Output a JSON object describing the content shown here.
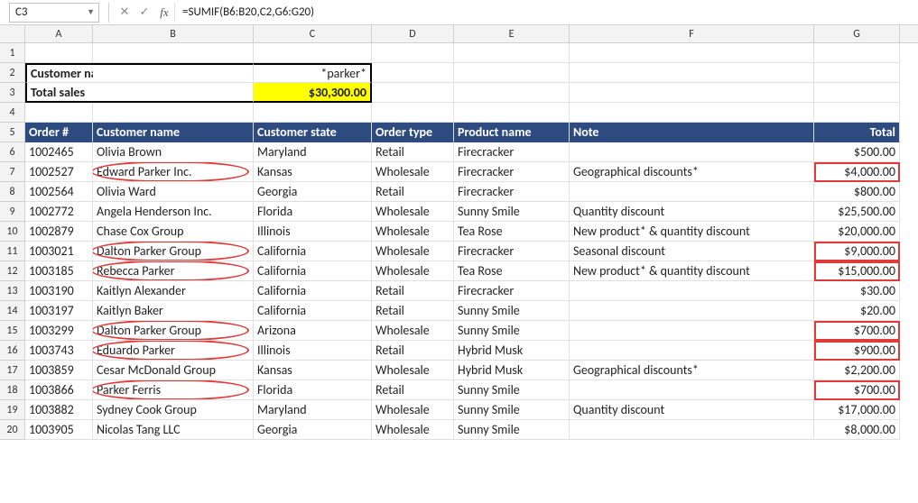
{
  "formula_bar": {
    "name_box": "C3",
    "formula": "=SUMIF(B6:B20,C2,G6:G20)",
    "cancel_icon": "✕",
    "enter_icon": "✓",
    "fx_label": "fx"
  },
  "columns": [
    "A",
    "B",
    "C",
    "D",
    "E",
    "F",
    "G"
  ],
  "summary": {
    "label1": "Customer name contains",
    "value1": "*parker*",
    "label2": "Total sales",
    "value2": "$30,300.00"
  },
  "table_headers": {
    "A": "Order #",
    "B": "Customer name",
    "C": "Customer state",
    "D": "Order type",
    "E": "Product name",
    "F": "Note",
    "G": "Total"
  },
  "rows": [
    {
      "r": 6,
      "A": "1002465",
      "B": "Olivia Brown",
      "C": "Maryland",
      "D": "Retail",
      "E": "Firecracker",
      "F": "",
      "G": "$500.00",
      "hB": false,
      "hG": false
    },
    {
      "r": 7,
      "A": "1002527",
      "B": "Edward Parker Inc.",
      "C": "Kansas",
      "D": "Wholesale",
      "E": "Firecracker",
      "F": "Geographical discounts*",
      "G": "$4,000.00",
      "hB": true,
      "hG": true
    },
    {
      "r": 8,
      "A": "1002564",
      "B": "Olivia Ward",
      "C": "Georgia",
      "D": "Retail",
      "E": "Firecracker",
      "F": "",
      "G": "$800.00",
      "hB": false,
      "hG": false
    },
    {
      "r": 9,
      "A": "1002772",
      "B": "Angela Henderson Inc.",
      "C": "Florida",
      "D": "Wholesale",
      "E": "Sunny Smile",
      "F": "Quantity discount",
      "G": "$25,500.00",
      "hB": false,
      "hG": false
    },
    {
      "r": 10,
      "A": "1002879",
      "B": "Chase Cox Group",
      "C": "Illinois",
      "D": "Wholesale",
      "E": "Tea Rose",
      "F": "New product* & quantity discount",
      "G": "$20,000.00",
      "hB": false,
      "hG": false
    },
    {
      "r": 11,
      "A": "1003021",
      "B": "Dalton Parker Group",
      "C": "California",
      "D": "Wholesale",
      "E": "Firecracker",
      "F": "Seasonal discount",
      "G": "$9,000.00",
      "hB": true,
      "hG": true
    },
    {
      "r": 12,
      "A": "1003185",
      "B": "Rebecca Parker",
      "C": "California",
      "D": "Wholesale",
      "E": "Tea Rose",
      "F": "New product* & quantity discount",
      "G": "$15,000.00",
      "hB": true,
      "hG": true
    },
    {
      "r": 13,
      "A": "1003190",
      "B": "Kaitlyn Alexander",
      "C": "California",
      "D": "Retail",
      "E": "Firecracker",
      "F": "",
      "G": "$30.00",
      "hB": false,
      "hG": false
    },
    {
      "r": 14,
      "A": "1003197",
      "B": "Kaitlyn Baker",
      "C": "California",
      "D": "Retail",
      "E": "Sunny Smile",
      "F": "",
      "G": "$20.00",
      "hB": false,
      "hG": false
    },
    {
      "r": 15,
      "A": "1003299",
      "B": "Dalton Parker Group",
      "C": "Arizona",
      "D": "Wholesale",
      "E": "Sunny Smile",
      "F": "",
      "G": "$700.00",
      "hB": true,
      "hG": true
    },
    {
      "r": 16,
      "A": "1003743",
      "B": "Eduardo Parker",
      "C": "Illinois",
      "D": "Retail",
      "E": "Hybrid Musk",
      "F": "",
      "G": "$900.00",
      "hB": true,
      "hG": true
    },
    {
      "r": 17,
      "A": "1003859",
      "B": "Cesar McDonald Group",
      "C": "Kansas",
      "D": "Wholesale",
      "E": "Hybrid Musk",
      "F": "Geographical discounts*",
      "G": "$2,200.00",
      "hB": false,
      "hG": false
    },
    {
      "r": 18,
      "A": "1003866",
      "B": "Parker Ferris",
      "C": "Florida",
      "D": "Retail",
      "E": "Sunny Smile",
      "F": "",
      "G": "$700.00",
      "hB": true,
      "hG": true
    },
    {
      "r": 19,
      "A": "1003882",
      "B": "Sydney Cook Group",
      "C": "Maryland",
      "D": "Wholesale",
      "E": "Sunny Smile",
      "F": "Quantity discount",
      "G": "$17,000.00",
      "hB": false,
      "hG": false
    },
    {
      "r": 20,
      "A": "1003905",
      "B": "Nicolas Tang LLC",
      "C": "Georgia",
      "D": "Wholesale",
      "E": "Sunny Smile",
      "F": "",
      "G": "$8,000.00",
      "hB": false,
      "hG": false
    }
  ]
}
